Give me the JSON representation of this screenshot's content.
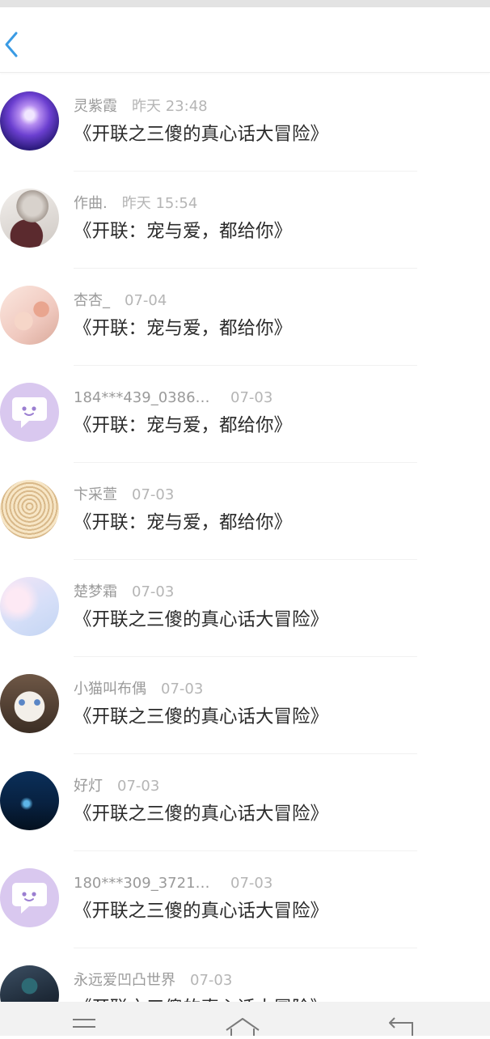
{
  "header": {
    "back_icon": "chevron-left-icon",
    "accent": "#3a9be4"
  },
  "messages": [
    {
      "name": "灵紫霞",
      "time": "昨天 23:48",
      "text": "《开联之三傻的真心话大冒险》",
      "avatar": "artwork-purple"
    },
    {
      "name": "作曲.",
      "time": "昨天 15:54",
      "text": "《开联：宠与爱，都给你》",
      "avatar": "anime-girl"
    },
    {
      "name": "杏杏_",
      "time": "07-04",
      "text": "《开联：宠与爱，都给你》",
      "avatar": "anime-pastel"
    },
    {
      "name": "184***439_0386…",
      "time": "07-03",
      "text": "《开联：宠与爱，都给你》",
      "avatar": "default-chat"
    },
    {
      "name": "卞采萱",
      "time": "07-03",
      "text": "《开联：宠与爱，都给你》",
      "avatar": "melon"
    },
    {
      "name": "楚梦霜",
      "time": "07-03",
      "text": "《开联之三傻的真心话大冒险》",
      "avatar": "pastel-sky"
    },
    {
      "name": "小猫叫布偶",
      "time": "07-03",
      "text": "《开联之三傻的真心话大冒险》",
      "avatar": "cat"
    },
    {
      "name": "好灯",
      "time": "07-03",
      "text": "《开联之三傻的真心话大冒险》",
      "avatar": "underwater"
    },
    {
      "name": "180***309_3721…",
      "time": "07-03",
      "text": "《开联之三傻的真心话大冒险》",
      "avatar": "default-chat"
    },
    {
      "name": "永远爱凹凸世界",
      "time": "07-03",
      "text": "《开联之三傻的真心话大冒险》",
      "avatar": "anime-dark"
    }
  ],
  "navbar": {
    "icons": [
      "menu-icon",
      "home-icon",
      "back-icon"
    ]
  }
}
